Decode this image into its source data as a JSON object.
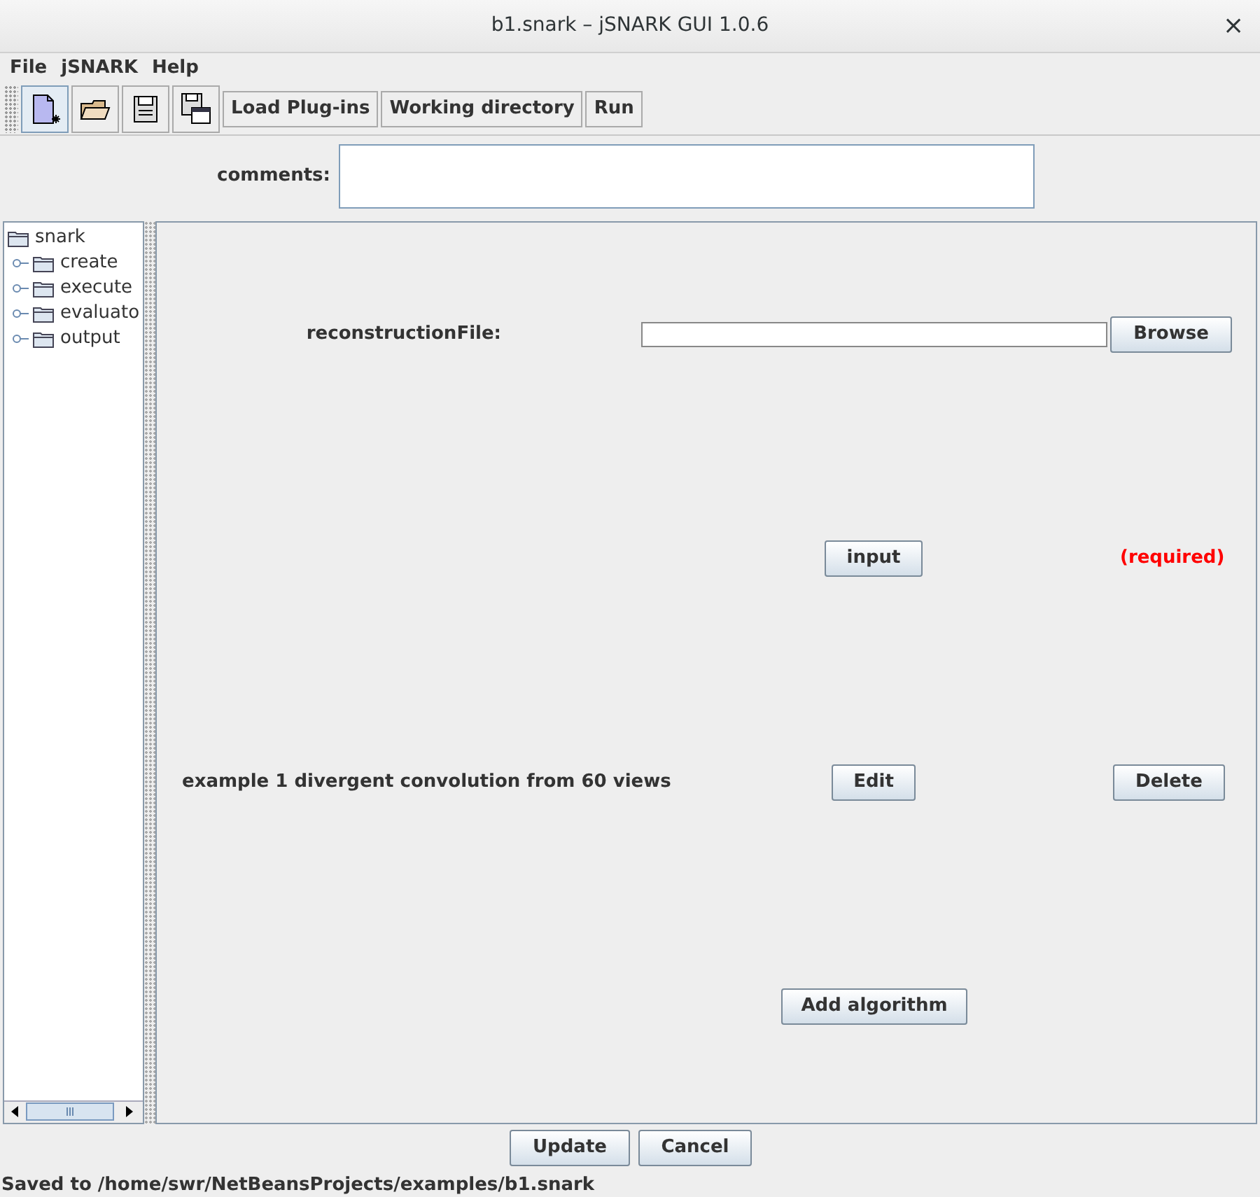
{
  "window": {
    "title": "b1.snark – jSNARK GUI 1.0.6",
    "close": "×"
  },
  "menu": [
    "File",
    "jSNARK",
    "Help"
  ],
  "toolbar": {
    "icon_buttons": [
      {
        "kind": "new",
        "selected": true
      },
      {
        "kind": "open",
        "selected": false
      },
      {
        "kind": "save",
        "selected": false
      },
      {
        "kind": "saveas",
        "selected": false
      }
    ],
    "buttons": [
      "Load Plug-ins",
      "Working directory",
      "Run"
    ]
  },
  "comments": {
    "label": "comments:"
  },
  "tree": {
    "label": "snark",
    "children": [
      {
        "label": "create",
        "expanded": false
      },
      {
        "label": "execute",
        "expanded": false
      },
      {
        "label": "evaluato",
        "expanded": false
      },
      {
        "label": "output",
        "expanded": false
      }
    ]
  },
  "form": {
    "reconstruction_label": "reconstructionFile:",
    "browse": "Browse",
    "input_button": "input",
    "required": "(required)",
    "algorithms": [
      {
        "name": "example 1 divergent convolution from 60 views",
        "edit": "Edit",
        "delete": "Delete"
      }
    ],
    "add": "Add algorithm"
  },
  "buttons": [
    "Update",
    "Cancel"
  ],
  "status_bar": "Saved to /home/swr/NetBeansProjects/examples/b1.snark"
}
